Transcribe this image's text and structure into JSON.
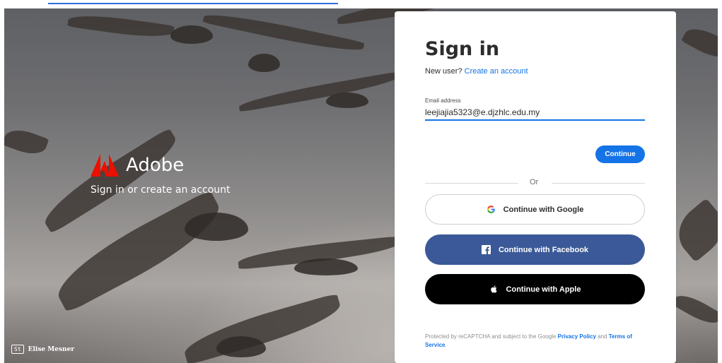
{
  "brand": {
    "name": "Adobe",
    "tagline": "Sign in or create an account",
    "accent": "#eb1000"
  },
  "credit": {
    "badge": "St",
    "name": "Elise Mesner"
  },
  "signin": {
    "title": "Sign in",
    "new_user_prefix": "New user?",
    "create_account": "Create an account",
    "email_label": "Email address",
    "email_value": "leejiajia5323@e.djzhlc.edu.my",
    "continue_label": "Continue",
    "or_label": "Or",
    "google_label": "Continue with Google",
    "facebook_label": "Continue with Facebook",
    "apple_label": "Continue with Apple",
    "legal_prefix": "Protected by reCAPTCHA and subject to the Google",
    "privacy_policy": "Privacy Policy",
    "legal_and": "and",
    "terms": "Terms of Service",
    "legal_suffix": "."
  },
  "colors": {
    "primary_blue": "#1473e6",
    "facebook_blue": "#3b5998",
    "apple_black": "#000000"
  },
  "icons": {
    "brand": "adobe-logo-icon",
    "google": "google-g-icon",
    "facebook": "facebook-f-icon",
    "apple": "apple-logo-icon"
  }
}
